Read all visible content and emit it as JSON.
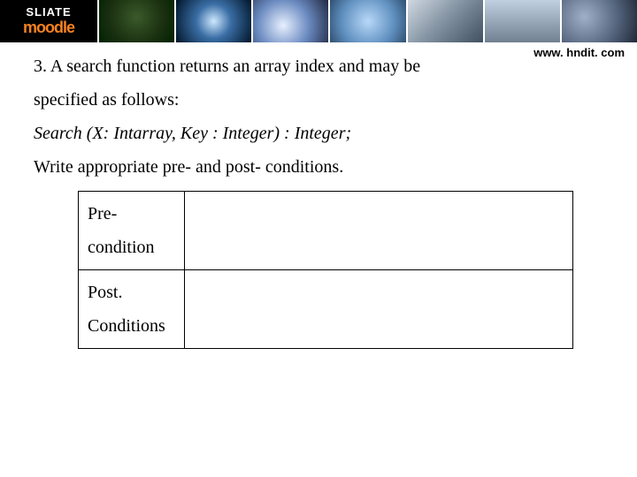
{
  "banner": {
    "logo_top": "SLIATE",
    "logo_bottom": "moodle"
  },
  "watermark": "www. hndit. com",
  "question": {
    "number_prefix": "3.   ",
    "line1": "A search function returns an array index and may be",
    "line2": "specified as follows:",
    "signature": "Search (X: Intarray,  Key : Integer) : Integer;",
    "instruction": "Write appropriate pre- and post- conditions."
  },
  "table": {
    "rows": [
      {
        "label": "Pre-condition",
        "value": ""
      },
      {
        "label": "Post. Conditions",
        "value": ""
      }
    ]
  }
}
